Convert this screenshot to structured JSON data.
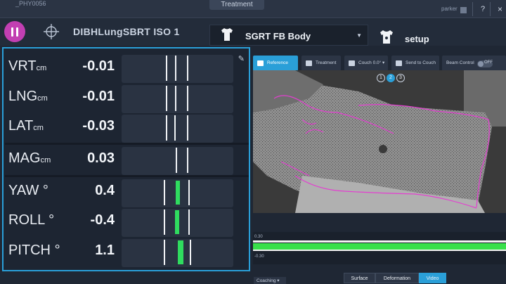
{
  "topbar": {
    "patient_id": "_PHY0056",
    "active_tab": "Treatment",
    "user": "parker",
    "help_label": "?",
    "close_label": "×"
  },
  "header": {
    "plan_name": "DIBHLungSBRT ISO 1",
    "region": "SGRT FB Body",
    "mode": "setup"
  },
  "deltas": [
    {
      "axis": "VRT",
      "unit": "cm",
      "value": "-0.01",
      "offset": -0.01
    },
    {
      "axis": "LNG",
      "unit": "cm",
      "value": "-0.01",
      "offset": -0.01
    },
    {
      "axis": "LAT",
      "unit": "cm",
      "value": "-0.03",
      "offset": -0.03
    },
    {
      "axis": "MAG",
      "unit": "cm",
      "value": "0.03",
      "offset": 0.03
    },
    {
      "axis": "YAW",
      "unit": "°",
      "value": "0.4",
      "offset": 0.4
    },
    {
      "axis": "ROLL",
      "unit": "°",
      "value": "-0.4",
      "offset": -0.4
    },
    {
      "axis": "PITCH",
      "unit": "°",
      "value": "1.1",
      "offset": 1.1
    }
  ],
  "video_toolbar": {
    "reference": "Reference",
    "treatment": "Treatment",
    "couch": "Couch 0.0°",
    "send_to_couch": "Send to Couch",
    "beam_control": "Beam Control",
    "beam_state": "OFF"
  },
  "cameras": [
    "1",
    "2",
    "3"
  ],
  "active_camera": "2",
  "trace": {
    "upper": "0.30",
    "lower": "-0.30"
  },
  "coaching": "Coaching",
  "view_modes": [
    "Surface",
    "Deformation",
    "Video"
  ],
  "active_view": "Video",
  "colors": {
    "accent": "#2a9fd8",
    "pause": "#c23fb2",
    "bar": "#2fdc5f",
    "contour": "#e33fd0"
  }
}
